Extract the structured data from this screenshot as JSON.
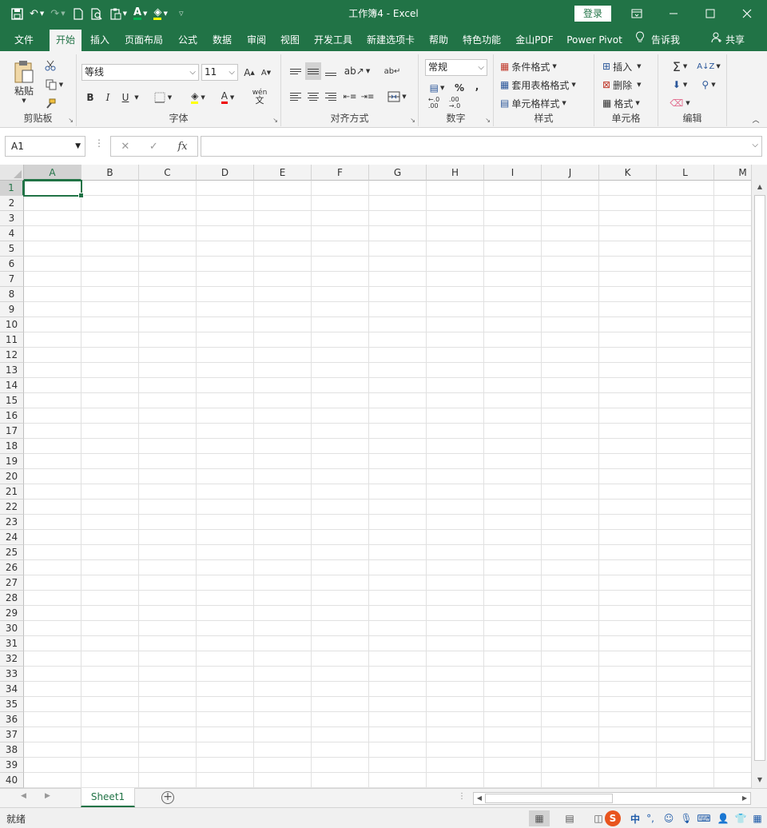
{
  "app": {
    "title": "工作簿4  -  Excel",
    "login_label": "登录"
  },
  "tabs": [
    {
      "label": "文件"
    },
    {
      "label": "开始",
      "active": true
    },
    {
      "label": "插入"
    },
    {
      "label": "页面布局"
    },
    {
      "label": "公式"
    },
    {
      "label": "数据"
    },
    {
      "label": "审阅"
    },
    {
      "label": "视图"
    },
    {
      "label": "开发工具"
    },
    {
      "label": "新建选项卡"
    },
    {
      "label": "帮助"
    },
    {
      "label": "特色功能"
    },
    {
      "label": "金山PDF"
    },
    {
      "label": "Power Pivot"
    }
  ],
  "tell_me": "告诉我",
  "share": "共享",
  "ribbon": {
    "clipboard": {
      "label": "剪贴板",
      "paste": "粘贴"
    },
    "font": {
      "label": "字体",
      "font_name": "等线",
      "font_size": "11",
      "bold": "B",
      "italic": "I",
      "underline": "U",
      "font_color_letter": "A",
      "phonetic": "wén"
    },
    "alignment": {
      "label": "对齐方式"
    },
    "number": {
      "label": "数字",
      "format": "常规",
      "percent": "%",
      "comma": ","
    },
    "styles": {
      "label": "样式",
      "conditional": "条件格式",
      "table": "套用表格格式",
      "cell_styles": "单元格样式"
    },
    "cells": {
      "label": "单元格",
      "insert": "插入",
      "delete": "删除",
      "format": "格式"
    },
    "editing": {
      "label": "编辑",
      "sum": "Σ"
    }
  },
  "formula_bar": {
    "name_box": "A1",
    "fx": "fx",
    "value": ""
  },
  "grid": {
    "columns": [
      "A",
      "B",
      "C",
      "D",
      "E",
      "F",
      "G",
      "H",
      "I",
      "J",
      "K",
      "L",
      "M"
    ],
    "rows": [
      "1",
      "2",
      "3",
      "4",
      "5",
      "6",
      "7",
      "8",
      "9",
      "10",
      "11",
      "12",
      "13",
      "14",
      "15",
      "16",
      "17",
      "18",
      "19",
      "20",
      "21",
      "22",
      "23",
      "24",
      "25",
      "26",
      "27",
      "28",
      "29",
      "30",
      "31",
      "32",
      "33",
      "34",
      "35",
      "36",
      "37",
      "38",
      "39",
      "40"
    ],
    "active_cell": "A1"
  },
  "sheets": [
    {
      "name": "Sheet1",
      "active": true
    }
  ],
  "status": {
    "ready": "就绪"
  },
  "ime": {
    "lang": "中"
  },
  "colors": {
    "brand": "#217346",
    "ribbon_bg": "#f3f3f3",
    "gridline": "#e1e1e1"
  }
}
